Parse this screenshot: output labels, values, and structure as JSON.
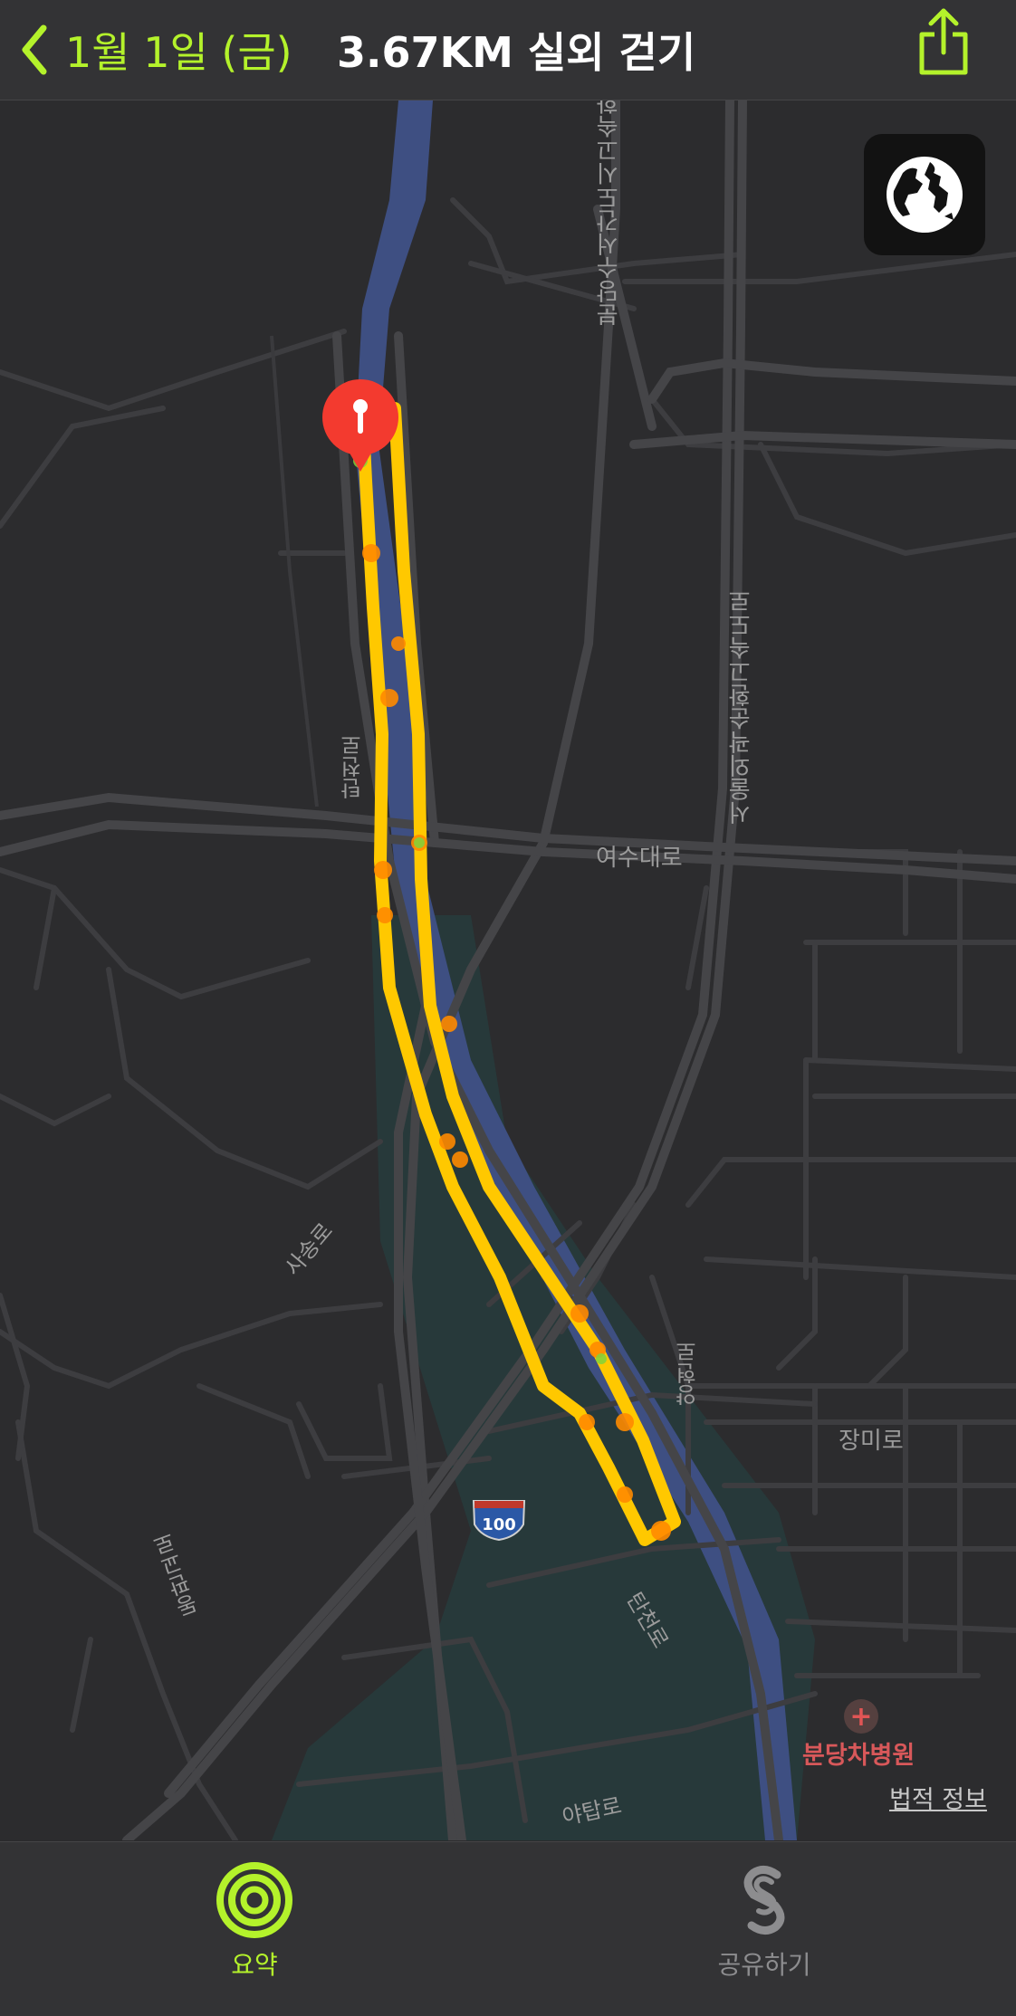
{
  "nav": {
    "back_label": "1월 1일 (금)",
    "title": "3.67KM 실외 걷기"
  },
  "map": {
    "labels": {
      "expressway_north": "분당수서간도시고속화",
      "ring_expressway": "서울외곽순환고속도로",
      "tancheon_north": "탄천로",
      "yeosu": "여수대로",
      "sasong": "사송로",
      "yanghyeon": "양현로",
      "jangmi": "장미로",
      "tancheon_south": "탄천로",
      "dongpan": "동판교로",
      "yatap": "야탑로",
      "route_shield": "100"
    },
    "poi": {
      "hospital_name": "분당차병원",
      "hospital_icon": "plus-icon"
    },
    "legal_link": "법적 정보",
    "route_colors": {
      "base": "#ffc800",
      "fast": "#ff8a00",
      "slow": "#7fd33b",
      "river": "#3e4f82",
      "park": "#27393a"
    },
    "icons": {
      "globe": "globe-icon",
      "pin": "start-pin-icon"
    }
  },
  "tabs": [
    {
      "label": "요약",
      "icon": "activity-rings-icon",
      "color": "#b4f22b",
      "selected": true
    },
    {
      "label": "공유하기",
      "icon": "sharing-icon",
      "color": "#8d8d8f",
      "selected": false
    }
  ],
  "accent": "#b4f22b"
}
